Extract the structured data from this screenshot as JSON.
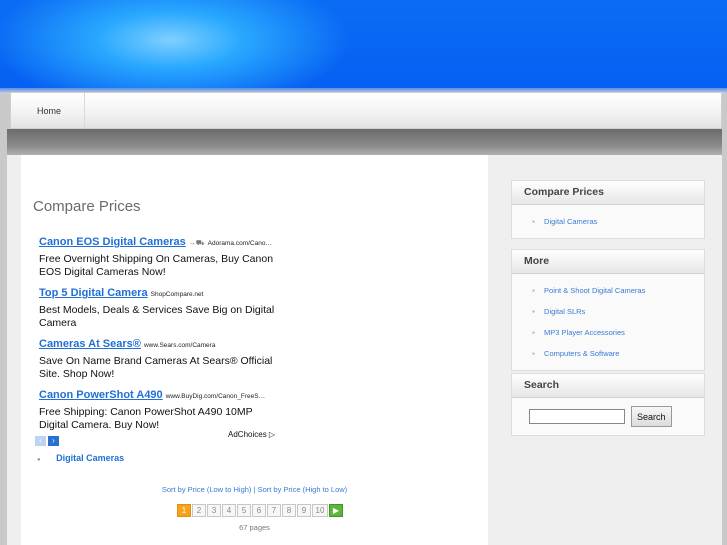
{
  "nav": {
    "home_label": "Home"
  },
  "main": {
    "title": "Compare Prices",
    "ads": [
      {
        "title": "Canon EOS Digital Cameras",
        "url": "Adorama.com/Cano…",
        "desc": "Free Overnight Shipping On Cameras, Buy Canon EOS Digital Cameras Now!"
      },
      {
        "title": "Top 5 Digital Camera",
        "url": "ShopCompare.net",
        "desc": "Best Models, Deals & Services Save Big on Digital Camera"
      },
      {
        "title": "Cameras At Sears®",
        "url": "www.Sears.com/Camera",
        "desc": "Save On Name Brand Cameras At Sears® Official Site. Shop Now!"
      },
      {
        "title": "Canon PowerShot A490",
        "url": "www.BuyDig.com/Canon_FreeS…",
        "desc": "Free Shipping: Canon PowerShot A490 10MP Digital Camera. Buy Now!"
      }
    ],
    "adchoices_label": "AdChoices",
    "category_link": "Digital Cameras",
    "sort": {
      "low_high": "Sort by Price (Low to High)",
      "separator": " | ",
      "high_low": "Sort by Price (High to Low)"
    },
    "pager": {
      "pages": [
        "1",
        "2",
        "3",
        "4",
        "5",
        "6",
        "7",
        "8",
        "9",
        "10"
      ],
      "current": "1",
      "pages_count": "67 pages"
    }
  },
  "sidebar": {
    "compare": {
      "title": "Compare Prices",
      "items": [
        "Digital Cameras"
      ]
    },
    "more": {
      "title": "More",
      "items": [
        "Point & Shoot Digital Cameras",
        "Digital SLRs",
        "MP3 Player Accessories",
        "Computers & Software"
      ]
    },
    "search": {
      "title": "Search",
      "button_label": "Search",
      "input_value": ""
    }
  }
}
